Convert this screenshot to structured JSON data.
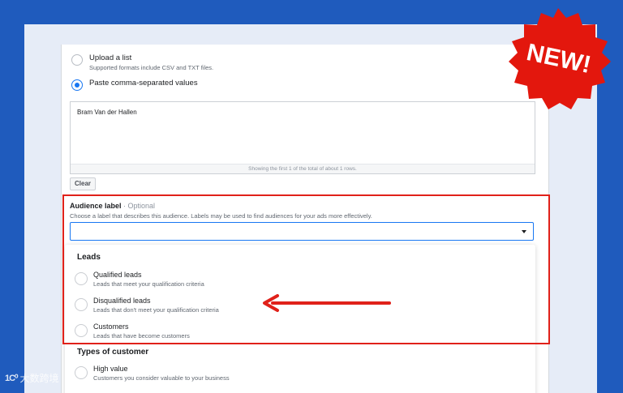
{
  "source_options": [
    {
      "label": "Upload a list",
      "sublabel": "Supported formats include CSV and TXT files.",
      "checked": false
    },
    {
      "label": "Paste comma-separated values",
      "sublabel": "",
      "checked": true
    }
  ],
  "textarea": {
    "value": "Bram Van der Hallen",
    "footer": "Showing the first 1 of the total of about 1 rows."
  },
  "clear_button": "Clear",
  "audience_label": {
    "title": "Audience label",
    "optional": " · Optional",
    "description": "Choose a label that describes this audience. Labels may be used to find audiences for your ads more effectively.",
    "value": ""
  },
  "dropdown": {
    "groups": [
      {
        "heading": "Leads",
        "options": [
          {
            "label": "Qualified leads",
            "sublabel": "Leads that meet your qualification criteria"
          },
          {
            "label": "Disqualified leads",
            "sublabel": "Leads that don't meet your qualification criteria"
          },
          {
            "label": "Customers",
            "sublabel": "Leads that have become customers"
          }
        ]
      },
      {
        "heading": "Types of customer",
        "options": [
          {
            "label": "High value",
            "sublabel": "Customers you consider valuable to your business"
          }
        ]
      }
    ]
  },
  "badge": {
    "text": "NEW!"
  },
  "watermark": {
    "mark": "1C⁰",
    "text": "大数跨境"
  },
  "colors": {
    "background": "#1f5bbd",
    "accent": "#1877f2",
    "highlight": "#e0211a"
  }
}
